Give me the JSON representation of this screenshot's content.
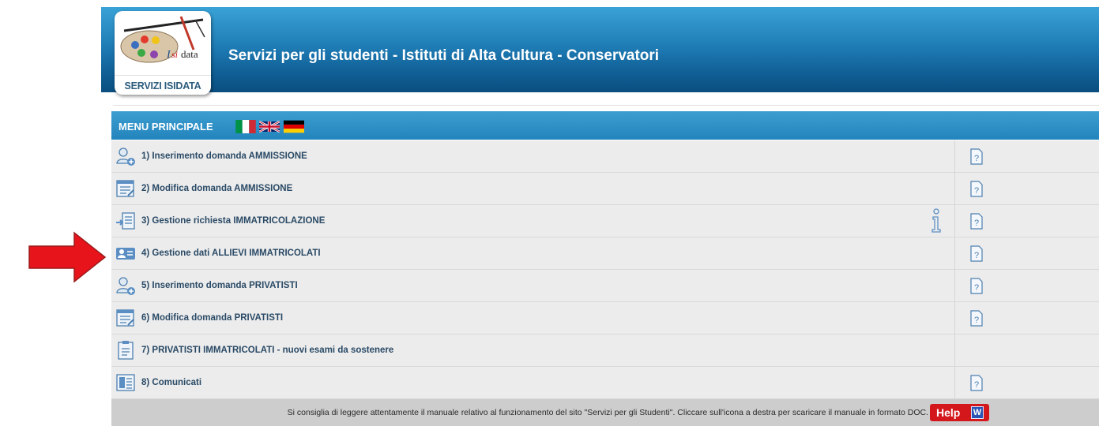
{
  "header": {
    "title": "Servizi per gli studenti - Istituti di Alta Cultura - Conservatori",
    "logo_label": "SERVIZI ISIDATA",
    "logo_word": "data"
  },
  "menu": {
    "title": "MENU PRINCIPALE",
    "languages": [
      "italian-flag",
      "uk-flag",
      "german-flag"
    ],
    "items": [
      {
        "label": "1) Inserimento domanda AMMISSIONE",
        "icon": "user-add-icon",
        "manual": true
      },
      {
        "label": "2) Modifica domanda AMMISSIONE",
        "icon": "edit-document-icon",
        "manual": true
      },
      {
        "label": "3) Gestione richiesta IMMATRICOLAZIONE",
        "icon": "enroll-request-icon",
        "manual": true,
        "info": true
      },
      {
        "label": "4) Gestione dati ALLIEVI IMMATRICOLATI",
        "icon": "student-card-icon",
        "manual": true
      },
      {
        "label": "5) Inserimento domanda PRIVATISTI",
        "icon": "user-add-icon",
        "manual": true
      },
      {
        "label": "6) Modifica domanda PRIVATISTI",
        "icon": "edit-document-icon",
        "manual": true
      },
      {
        "label": "7) PRIVATISTI IMMATRICOLATI - nuovi esami da sostenere",
        "icon": "clipboard-icon",
        "manual": false
      },
      {
        "label": "8) Comunicati",
        "icon": "news-icon",
        "manual": true
      }
    ]
  },
  "footer": {
    "text": "Si consiglia di leggere attentamente il manuale relativo al funzionamento del sito \"Servizi per gli Studenti\". Cliccare sull'icona a destra per scaricare il manuale in formato DOC.",
    "help_label": "Help",
    "help_icon_letter": "W"
  },
  "colors": {
    "header_blue": "#1f7db6",
    "menu_blue": "#2384bd",
    "row_bg": "#ececec",
    "label_text": "#2a4a66",
    "help_red": "#d4171b",
    "arrow_red": "#e8141b"
  }
}
